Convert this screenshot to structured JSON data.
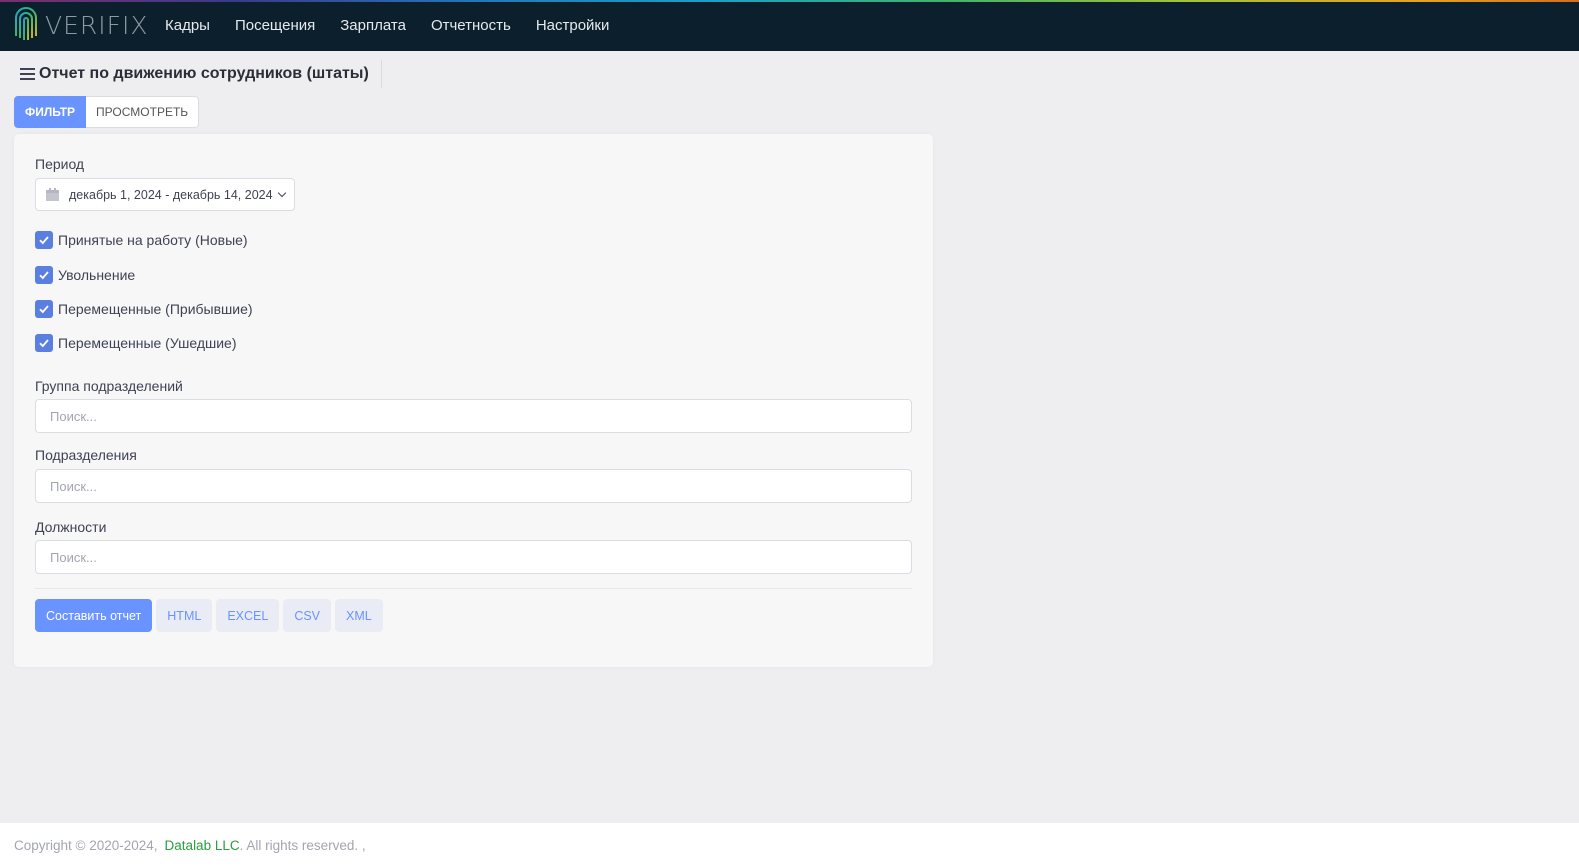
{
  "brand": {
    "name": "VERIFIX"
  },
  "nav": [
    {
      "label": "Кадры"
    },
    {
      "label": "Посещения"
    },
    {
      "label": "Зарплата"
    },
    {
      "label": "Отчетность"
    },
    {
      "label": "Настройки"
    }
  ],
  "page": {
    "title": "Отчет по движению сотрудников (штаты)"
  },
  "tabs": [
    {
      "label": "ФИЛЬТР",
      "active": true
    },
    {
      "label": "ПРОСМОТРЕТЬ",
      "active": false
    }
  ],
  "filter": {
    "period_label": "Период",
    "period_value": "декабрь 1, 2024 - декабрь 14, 2024",
    "checkboxes": [
      {
        "label": "Принятые на работу (Новые)",
        "checked": true
      },
      {
        "label": "Увольнение",
        "checked": true
      },
      {
        "label": "Перемещенные (Прибывшие)",
        "checked": true
      },
      {
        "label": "Перемещенные (Ушедшие)",
        "checked": true
      }
    ],
    "division_group_label": "Группа подразделений",
    "divisions_label": "Подразделения",
    "positions_label": "Должности",
    "search_placeholder": "Поиск..."
  },
  "actions": {
    "build": "Составить отчет",
    "html": "HTML",
    "excel": "EXCEL",
    "csv": "CSV",
    "xml": "XML"
  },
  "footer": {
    "copyright": "Copyright © 2020-2024,",
    "company": "Datalab LLC",
    "rights": ". All rights reserved. ,"
  },
  "colors": {
    "primary": "#6993ff",
    "topbar": "#0c1f2c",
    "link": "#2b9d3e"
  }
}
